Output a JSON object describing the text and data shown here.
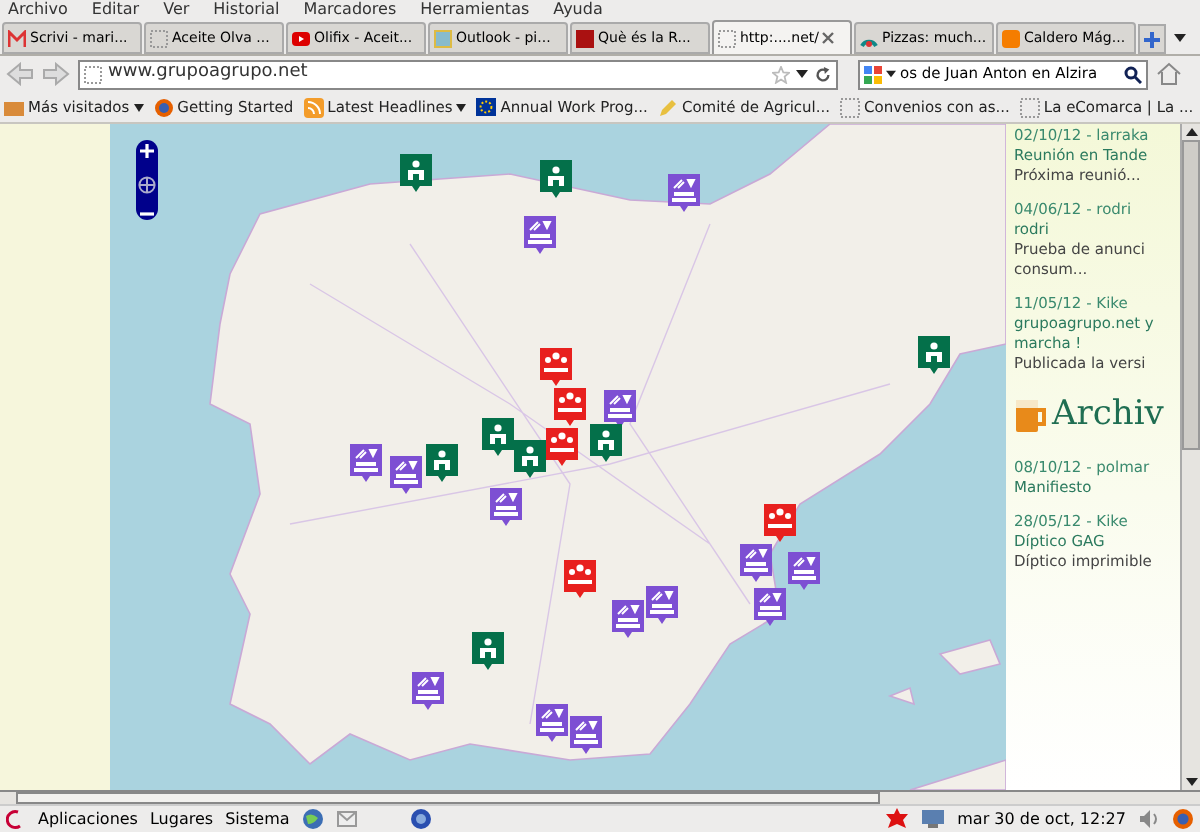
{
  "menu_bar": [
    "Archivo",
    "Editar",
    "Ver",
    "Historial",
    "Marcadores",
    "Herramientas",
    "Ayuda"
  ],
  "tabs": [
    {
      "label": "Scrivi - mari...",
      "selected": false,
      "kind": "mail"
    },
    {
      "label": "Aceite Olva ...",
      "selected": false,
      "kind": "page"
    },
    {
      "label": "Olifix - Aceit...",
      "selected": false,
      "kind": "video"
    },
    {
      "label": "Outlook - pi...",
      "selected": false,
      "kind": "outlook"
    },
    {
      "label": "Què és la R...",
      "selected": false,
      "kind": "book"
    },
    {
      "label": "http:....net/",
      "selected": true,
      "kind": "page"
    },
    {
      "label": "Pizzas: much...",
      "selected": false,
      "kind": "arc"
    },
    {
      "label": "Caldero Mág...",
      "selected": false,
      "kind": "blog"
    }
  ],
  "address_bar": {
    "value": "www.grupoagrupo.net"
  },
  "search_bar": {
    "value": "os de Juan Anton en Alzira"
  },
  "bookmarks": [
    {
      "label": "Más visitados",
      "kind": "folder",
      "dropdown": true
    },
    {
      "label": "Getting Started",
      "kind": "firefox",
      "dropdown": false
    },
    {
      "label": "Latest Headlines",
      "kind": "rss",
      "dropdown": true
    },
    {
      "label": "Annual Work Prog...",
      "kind": "eu",
      "dropdown": false
    },
    {
      "label": "Comité de Agricul...",
      "kind": "pencil",
      "dropdown": false
    },
    {
      "label": "Convenios con as...",
      "kind": "page",
      "dropdown": false
    },
    {
      "label": "La eComarca | La ...",
      "kind": "page",
      "dropdown": false
    }
  ],
  "map": {
    "markers": [
      {
        "kind": "producer",
        "color": "#04704a"
      },
      {
        "kind": "producer",
        "color": "#04704a"
      },
      {
        "kind": "producer",
        "color": "#04704a"
      },
      {
        "kind": "producer",
        "color": "#04704a"
      },
      {
        "kind": "group",
        "color": "#7d4fd3"
      },
      {
        "kind": "group",
        "color": "#7d4fd3"
      },
      {
        "kind": "group",
        "color": "#7d4fd3"
      },
      {
        "kind": "group",
        "color": "#7d4fd3"
      },
      {
        "kind": "group",
        "color": "#7d4fd3"
      },
      {
        "kind": "group",
        "color": "#7d4fd3"
      },
      {
        "kind": "group",
        "color": "#7d4fd3"
      },
      {
        "kind": "group",
        "color": "#7d4fd3"
      },
      {
        "kind": "group",
        "color": "#7d4fd3"
      },
      {
        "kind": "group",
        "color": "#7d4fd3"
      },
      {
        "kind": "group",
        "color": "#7d4fd3"
      },
      {
        "kind": "group",
        "color": "#7d4fd3"
      },
      {
        "kind": "group",
        "color": "#7d4fd3"
      },
      {
        "kind": "group",
        "color": "#7d4fd3"
      },
      {
        "kind": "producer",
        "color": "#04704a"
      },
      {
        "kind": "producer",
        "color": "#04704a"
      },
      {
        "kind": "producer",
        "color": "#04704a"
      },
      {
        "kind": "producer",
        "color": "#04704a"
      },
      {
        "kind": "meeting",
        "color": "#e8201e"
      },
      {
        "kind": "meeting",
        "color": "#e8201e"
      },
      {
        "kind": "meeting",
        "color": "#e8201e"
      },
      {
        "kind": "meeting",
        "color": "#e8201e"
      },
      {
        "kind": "meeting",
        "color": "#e8201e"
      }
    ]
  },
  "sidebar": {
    "news": [
      {
        "meta": "02/10/12 - larraka",
        "title": "Reunión en Tande",
        "excerpt": "Próxima reunió..."
      },
      {
        "meta": "04/06/12 - rodri",
        "title": "rodri",
        "excerpt": "Prueba de anunci consum..."
      },
      {
        "meta": "11/05/12 - Kike",
        "title": "grupoagrupo.net y marcha !",
        "excerpt": "Publicada la versi"
      }
    ],
    "archive_heading": "Archiv",
    "archive": [
      {
        "meta": "08/10/12 - polmar",
        "title": "Manifiesto"
      },
      {
        "meta": "28/05/12 - Kike",
        "title": "Díptico GAG",
        "excerpt": "Díptico imprimible"
      }
    ]
  },
  "taskbar": {
    "menus": [
      "Aplicaciones",
      "Lugares",
      "Sistema"
    ],
    "clock": "mar 30 de oct, 12:27"
  }
}
